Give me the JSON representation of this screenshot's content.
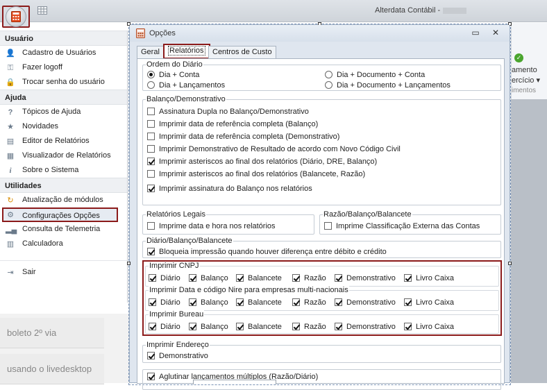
{
  "window": {
    "title": "Alterdata Contábil -"
  },
  "menu": {
    "sections": [
      {
        "title": "Usuário",
        "items": [
          {
            "label": "Cadastro de Usuários",
            "icon": "user-icon"
          },
          {
            "label": "Fazer logoff",
            "icon": "key-icon"
          },
          {
            "label": "Trocar senha do usuário",
            "icon": "lock-icon"
          }
        ]
      },
      {
        "title": "Ajuda",
        "items": [
          {
            "label": "Tópicos de Ajuda",
            "icon": "help-icon"
          },
          {
            "label": "Novidades",
            "icon": "star-icon"
          },
          {
            "label": "Editor de Relatórios",
            "icon": "report-editor-icon"
          },
          {
            "label": "Visualizador de Relatórios",
            "icon": "report-viewer-icon"
          },
          {
            "label": "Sobre o Sistema",
            "icon": "info-icon"
          }
        ]
      },
      {
        "title": "Utilidades",
        "items": [
          {
            "label": "Atualização de módulos",
            "icon": "refresh-icon"
          },
          {
            "label": "Configurações Opções",
            "icon": "gear-icon",
            "selected": true
          },
          {
            "label": "Consulta de Telemetria",
            "icon": "chart-icon"
          },
          {
            "label": "Calculadora",
            "icon": "calculator-icon"
          }
        ]
      }
    ],
    "exit_label": "Sair"
  },
  "left_cards": [
    "boleto 2º via",
    "usando o livedesktop"
  ],
  "ribbon_right": {
    "line1": "amento",
    "line2": "ercício ▾",
    "group": "imentos"
  },
  "dialog": {
    "title": "Opções",
    "tabs": [
      "Geral",
      "Relatórios",
      "Centros de Custo"
    ],
    "active_tab": "Relatórios",
    "ordem": {
      "legend": "Ordem do Diário",
      "options": [
        "Dia + Conta",
        "Dia + Lançamentos",
        "Dia + Documento + Conta",
        "Dia + Documento + Lançamentos"
      ],
      "selected": "Dia + Conta"
    },
    "balanco": {
      "legend": "Balanço/Demonstrativo",
      "items": [
        {
          "label": "Assinatura Dupla no Balanço/Demonstrativo",
          "checked": false
        },
        {
          "label": "Imprimir data de referência completa (Balanço)",
          "checked": false
        },
        {
          "label": "Imprimir data de referência completa (Demonstrativo)",
          "checked": false
        },
        {
          "label": "Imprimir Demonstrativo de Resultado de acordo com Novo Código Civil",
          "checked": false
        },
        {
          "label": "Imprimir asteriscos ao final dos relatórios (Diário, DRE, Balanço)",
          "checked": true
        },
        {
          "label": "Imprimir asteriscos ao final dos relatórios (Balancete, Razão)",
          "checked": false
        },
        {
          "label": "Imprimir assinatura do Balanço nos relatórios",
          "checked": true
        }
      ]
    },
    "legais": {
      "legend": "Relatórios Legais",
      "label": "Imprime data e hora nos relatórios",
      "checked": false
    },
    "razao": {
      "legend": "Razão/Balanço/Balancete",
      "label": "Imprime Classificação Externa das Contas",
      "checked": false
    },
    "diario_balanco": {
      "legend": "Diário/Balanço/Balancete",
      "label": "Bloqueia impressão quando houver diferença entre débito e crédito",
      "checked": true
    },
    "print_groups": [
      {
        "legend": "Imprimir CNPJ"
      },
      {
        "legend": "Imprimir Data e código Nire para empresas multi-nacionais"
      },
      {
        "legend": "Imprimir Bureau"
      }
    ],
    "print_options": [
      "Diário",
      "Balanço",
      "Balancete",
      "Razão",
      "Demonstrativo",
      "Livro Caixa"
    ],
    "endereco": {
      "legend": "Imprimir Endereço",
      "label": "Demonstrativo",
      "checked": true
    },
    "aglutinar": {
      "label": "Aglutinar lançamentos múltiplos (Razão/Diário)",
      "checked": true
    }
  }
}
